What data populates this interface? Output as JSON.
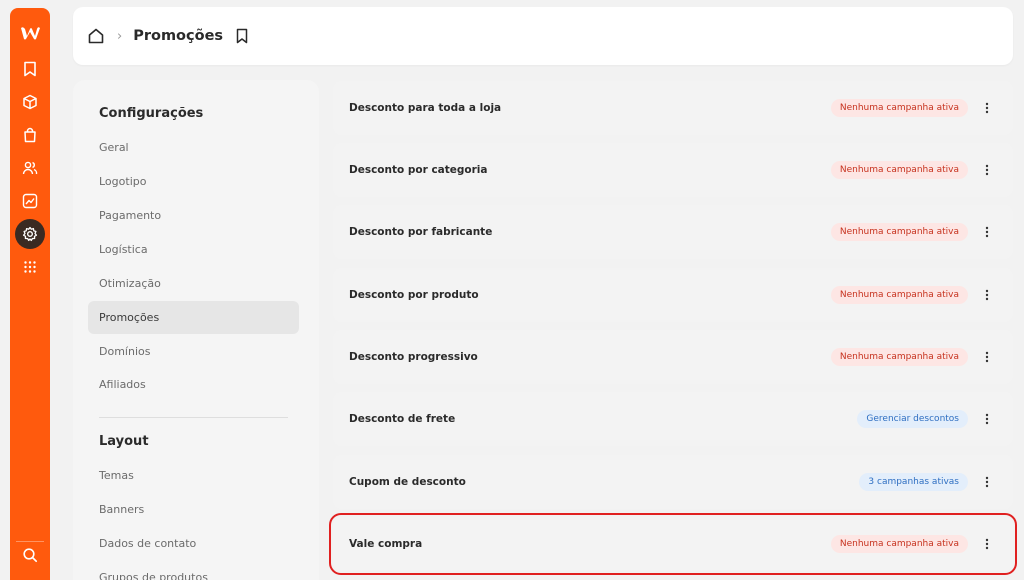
{
  "colors": {
    "accent": "#ff5a0d",
    "danger": "#c7331f",
    "info": "#2f6fc2",
    "highlight": "#e02020"
  },
  "rail": {
    "logo_icon": "w-logo-icon",
    "icons": [
      "bookmark-icon",
      "box-icon",
      "shopping-bag-icon",
      "users-icon",
      "chart-icon",
      "gear-icon",
      "apps-grid-icon"
    ],
    "active": "gear-icon",
    "bottom_icons": [
      "search-icon",
      "help-icon"
    ]
  },
  "header": {
    "title": "Promoções",
    "separator": "›",
    "home_icon": "home-icon",
    "bookmark_icon": "bookmark-icon"
  },
  "settings": {
    "section_configuracoes": "Configurações",
    "items": [
      "Geral",
      "Logotipo",
      "Pagamento",
      "Logística",
      "Otimização",
      "Promoções",
      "Domínios",
      "Afiliados"
    ],
    "active_item": "Promoções",
    "section_layout": "Layout",
    "layout_items": [
      "Temas",
      "Banners",
      "Dados de contato",
      "Grupos de produtos"
    ]
  },
  "promotions": [
    {
      "title": "Desconto para toda a loja",
      "status": "Nenhuma campanha ativa",
      "status_type": "red"
    },
    {
      "title": "Desconto por categoria",
      "status": "Nenhuma campanha ativa",
      "status_type": "red"
    },
    {
      "title": "Desconto por fabricante",
      "status": "Nenhuma campanha ativa",
      "status_type": "red"
    },
    {
      "title": "Desconto por produto",
      "status": "Nenhuma campanha ativa",
      "status_type": "red"
    },
    {
      "title": "Desconto progressivo",
      "status": "Nenhuma campanha ativa",
      "status_type": "red"
    },
    {
      "title": "Desconto de frete",
      "status": "Gerenciar descontos",
      "status_type": "blue"
    },
    {
      "title": "Cupom de desconto",
      "status": "3 campanhas ativas",
      "status_type": "blue"
    },
    {
      "title": "Vale compra",
      "status": "Nenhuma campanha ativa",
      "status_type": "red",
      "highlighted": true
    }
  ]
}
